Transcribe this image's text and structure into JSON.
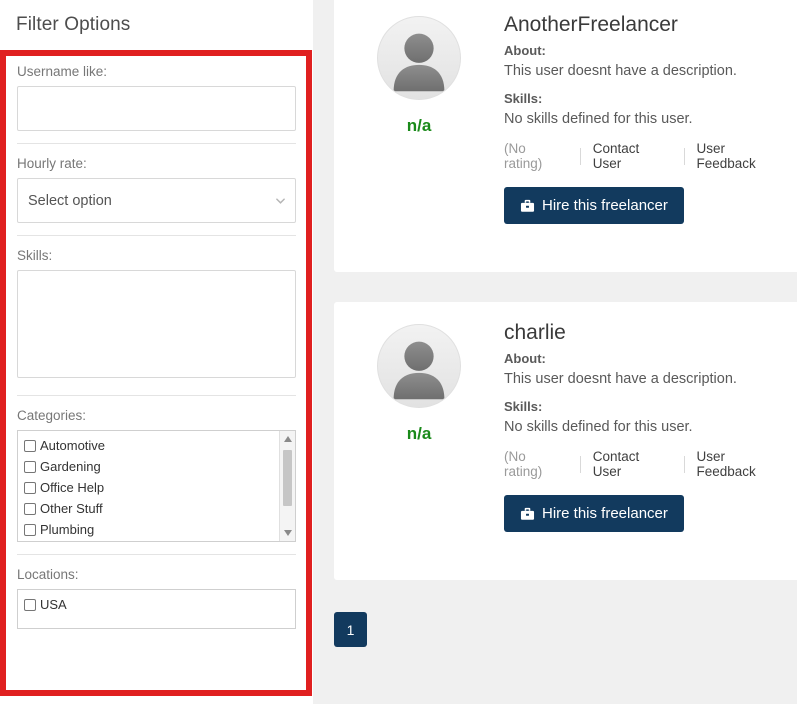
{
  "sidebar": {
    "title": "Filter Options",
    "username_field": {
      "label": "Username like:",
      "value": "",
      "placeholder": ""
    },
    "hourly_rate": {
      "label": "Hourly rate:",
      "selected": "Select option",
      "chevron_icon": "chevron-down-icon"
    },
    "skills": {
      "label": "Skills:",
      "value": "",
      "placeholder": ""
    },
    "categories": {
      "label": "Categories:",
      "options": [
        {
          "label": "Automotive",
          "checked": false
        },
        {
          "label": "Gardening",
          "checked": false
        },
        {
          "label": "Office Help",
          "checked": false
        },
        {
          "label": "Other Stuff",
          "checked": false
        },
        {
          "label": "Plumbing",
          "checked": false
        }
      ]
    },
    "locations": {
      "label": "Locations:",
      "options": [
        {
          "label": "USA",
          "checked": false
        }
      ]
    },
    "highlight_color": "#e02020"
  },
  "main": {
    "cards": [
      {
        "username": "AnotherFreelancer",
        "about_label": "About:",
        "about_text": "This user doesnt have a description.",
        "skills_label": "Skills:",
        "skills_text": "No skills defined for this user.",
        "rating_badge": "n/a",
        "rating_text": "(No rating)",
        "contact_link": "Contact User",
        "feedback_link": "User Feedback",
        "hire_button": "Hire this freelancer",
        "avatar_icon": "user-avatar-icon",
        "hire_icon": "briefcase-icon"
      },
      {
        "username": "charlie",
        "about_label": "About:",
        "about_text": "This user doesnt have a description.",
        "skills_label": "Skills:",
        "skills_text": "No skills defined for this user.",
        "rating_badge": "n/a",
        "rating_text": "(No rating)",
        "contact_link": "Contact User",
        "feedback_link": "User Feedback",
        "hire_button": "Hire this freelancer",
        "avatar_icon": "user-avatar-icon",
        "hire_icon": "briefcase-icon"
      }
    ],
    "pagination": {
      "current": "1"
    },
    "accent_color": "#123a5e",
    "rating_color": "#1a8a1a"
  }
}
